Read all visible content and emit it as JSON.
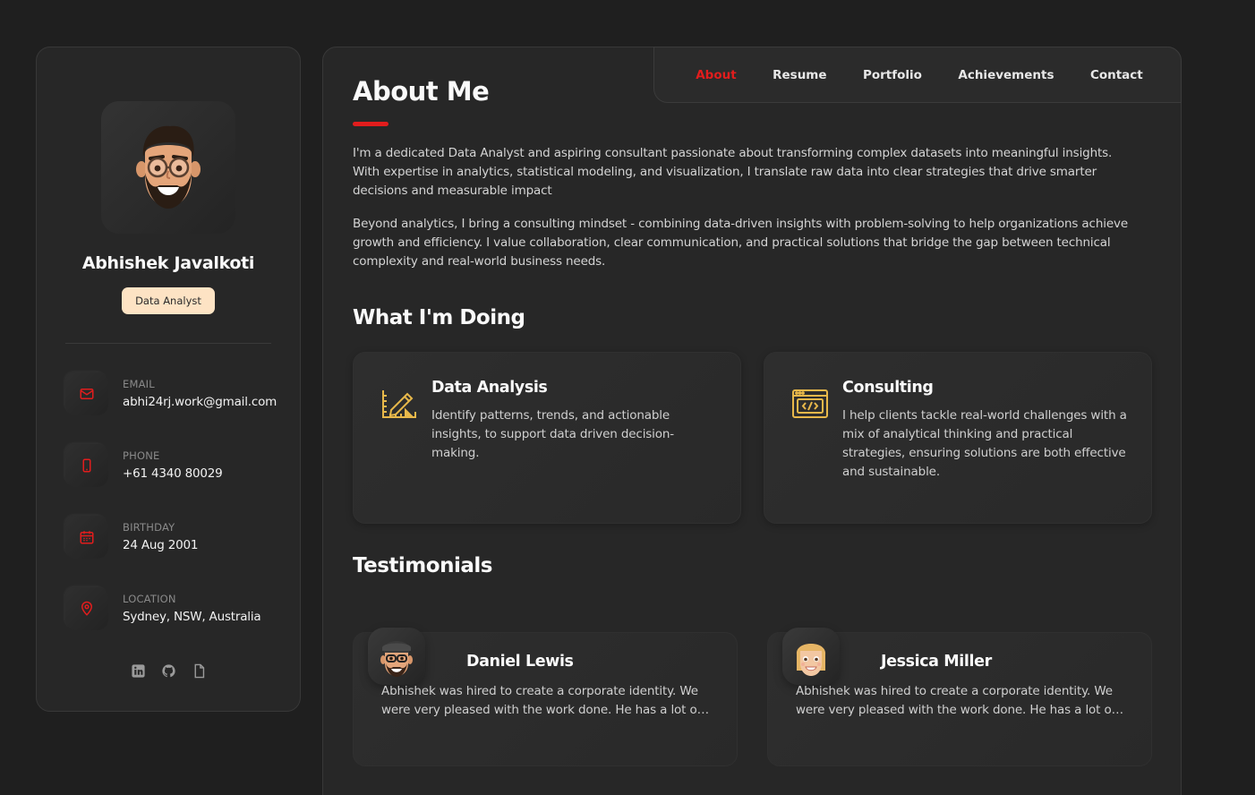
{
  "profile": {
    "name": "Abhishek Javalkoti",
    "title": "Data Analyst",
    "avatar_icon": "memoji-avatar-icon"
  },
  "contacts": [
    {
      "label": "EMAIL",
      "value": "abhi24rj.work@gmail.com",
      "icon": "mail-icon"
    },
    {
      "label": "PHONE",
      "value": "+61 4340 80029",
      "icon": "phone-icon"
    },
    {
      "label": "BIRTHDAY",
      "value": "24 Aug 2001",
      "icon": "calendar-icon"
    },
    {
      "label": "LOCATION",
      "value": "Sydney, NSW, Australia",
      "icon": "location-icon"
    }
  ],
  "socials": [
    "linkedin-icon",
    "github-icon",
    "document-icon"
  ],
  "nav": {
    "items": [
      "About",
      "Resume",
      "Portfolio",
      "Achievements",
      "Contact"
    ],
    "active": "About"
  },
  "about": {
    "title": "About Me",
    "paragraphs": [
      "I'm a dedicated Data Analyst and aspiring consultant passionate about transforming complex datasets into meaningful insights. With expertise in analytics, statistical modeling, and visualization, I translate raw data into clear strategies that drive smarter decisions and measurable impact",
      "Beyond analytics, I bring a consulting mindset - combining data-driven insights with problem-solving to help organizations achieve growth and efficiency. I value collaboration, clear communication, and practical solutions that bridge the gap between technical complexity and real-world business needs."
    ]
  },
  "services": {
    "title": "What I'm Doing",
    "items": [
      {
        "title": "Data Analysis",
        "text": "Identify patterns, trends, and actionable insights, to support data driven decision-making.",
        "icon": "design-pencil-icon"
      },
      {
        "title": "Consulting",
        "text": "I help clients tackle real-world challenges with a mix of analytical thinking and practical strategies, ensuring solutions are both effective and sustainable.",
        "icon": "code-window-icon"
      }
    ]
  },
  "testimonials": {
    "title": "Testimonials",
    "items": [
      {
        "name": "Daniel Lewis",
        "text": "Abhishek was hired to create a corporate identity. We were very pleased with the work done. He has a lot of experience and is very concerned about the needs of client.",
        "avatar": "male-avatar-icon"
      },
      {
        "name": "Jessica Miller",
        "text": "Abhishek was hired to create a corporate identity. We were very pleased with the work done. He has a lot of experience and is very concerned about the needs of client.",
        "avatar": "female-avatar-icon"
      }
    ]
  },
  "colors": {
    "accent": "#e11d1d",
    "badge_bg": "#fde3c4",
    "service_icon": "#e8b84a",
    "background": "#1f1f1f",
    "card": "#272727"
  }
}
